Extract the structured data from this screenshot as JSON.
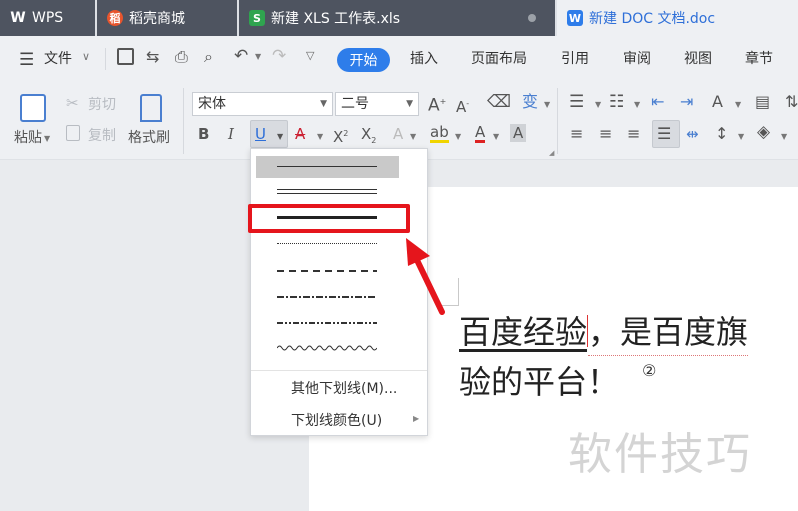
{
  "tabs": [
    {
      "label": "WPS",
      "icon": "wps-logo-icon"
    },
    {
      "label": "稻壳商城",
      "icon": "docer-icon"
    },
    {
      "label": "新建 XLS 工作表.xls",
      "icon": "spreadsheet-icon"
    },
    {
      "label": "新建 DOC 文档.doc",
      "icon": "writer-icon"
    }
  ],
  "menu": {
    "file": "文件",
    "items": [
      "开始",
      "插入",
      "页面布局",
      "引用",
      "审阅",
      "视图",
      "章节"
    ]
  },
  "ribbon": {
    "paste": "粘贴",
    "cut": "剪切",
    "copy": "复制",
    "format_painter": "格式刷",
    "font_name": "宋体",
    "font_size": "二号"
  },
  "underline_menu": {
    "styles": [
      "single-selected",
      "double",
      "thick",
      "dotted",
      "dashed",
      "dash-dot",
      "dash-dot-dot",
      "wavy"
    ],
    "more": "其他下划线(M)...",
    "color": "下划线颜色(U)"
  },
  "document": {
    "underlined": "百度经验",
    "line1_rest": "，是百度旗",
    "line2": "验的平台！",
    "mark": "②"
  },
  "watermark": "软件技巧",
  "colors": {
    "accent": "#2e7dea",
    "highlight": "#e5151c"
  }
}
